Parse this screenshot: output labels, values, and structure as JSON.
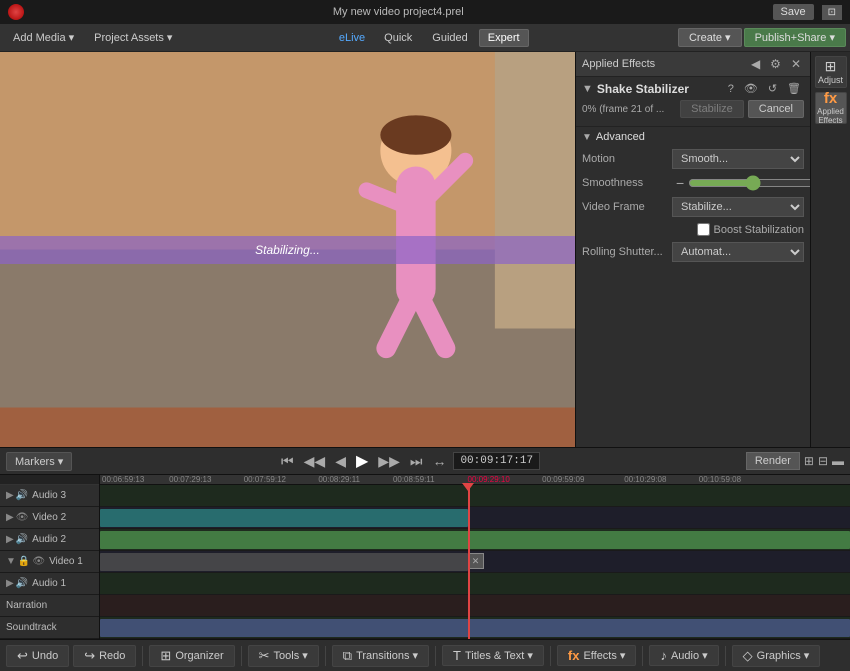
{
  "topbar": {
    "title": "My new video project4.prel",
    "save_label": "Save"
  },
  "navbar": {
    "addmedia_label": "Add Media ▾",
    "projectassets_label": "Project Assets ▾",
    "elive_label": "eLive",
    "quick_label": "Quick",
    "guided_label": "Guided",
    "expert_label": "Expert",
    "create_label": "Create ▾",
    "publish_label": "Publish+Share ▾"
  },
  "preview": {
    "stabilizing_text": "Stabilizing..."
  },
  "effects_panel": {
    "title": "Applied Effects",
    "shake_stabilizer_title": "Shake Stabilizer",
    "progress_text": "0% (frame 21 of ...",
    "stabilize_label": "Stabilize",
    "cancel_label": "Cancel",
    "advanced_label": "Advanced",
    "motion_label": "Motion",
    "motion_value": "Smooth...",
    "smoothness_label": "Smoothness",
    "smoothness_value": "50 %",
    "smoothness_number": 50,
    "video_frame_label": "Video Frame",
    "video_frame_value": "Stabilize...",
    "boost_label": "Boost Stabilization",
    "rolling_shutter_label": "Rolling Shutter...",
    "rolling_value": "Automat..."
  },
  "right_panel": {
    "adjust_label": "Adjust",
    "fx_label": "fx",
    "applied_effects_label": "Applied Effects"
  },
  "timeline": {
    "markers_label": "Markers ▾",
    "time_display": "00:09:17:17",
    "render_label": "Render",
    "tracks": [
      {
        "name": "Audio 3",
        "type": "audio"
      },
      {
        "name": "Video 2",
        "type": "video"
      },
      {
        "name": "Audio 2",
        "type": "audio"
      },
      {
        "name": "Video 1",
        "type": "video"
      },
      {
        "name": "Audio 1",
        "type": "audio"
      },
      {
        "name": "Narration",
        "type": "narr"
      },
      {
        "name": "Soundtrack",
        "type": "audio"
      }
    ],
    "ruler_times": [
      "00:06:59:13",
      "00:07:29:13",
      "00:07:59:12",
      "00:08:29:11",
      "00:08:59:11",
      "00:09:29:10",
      "00:09:59:09",
      "00:10:29:08",
      "00:10:59:08"
    ]
  },
  "bottom_toolbar": {
    "undo_label": "Undo",
    "redo_label": "Redo",
    "organizer_label": "Organizer",
    "tools_label": "Tools ▾",
    "transitions_label": "Transitions ▾",
    "titles_label": "Titles & Text ▾",
    "effects_label": "Effects ▾",
    "audio_label": "Audio ▾",
    "graphics_label": "Graphics ▾"
  }
}
